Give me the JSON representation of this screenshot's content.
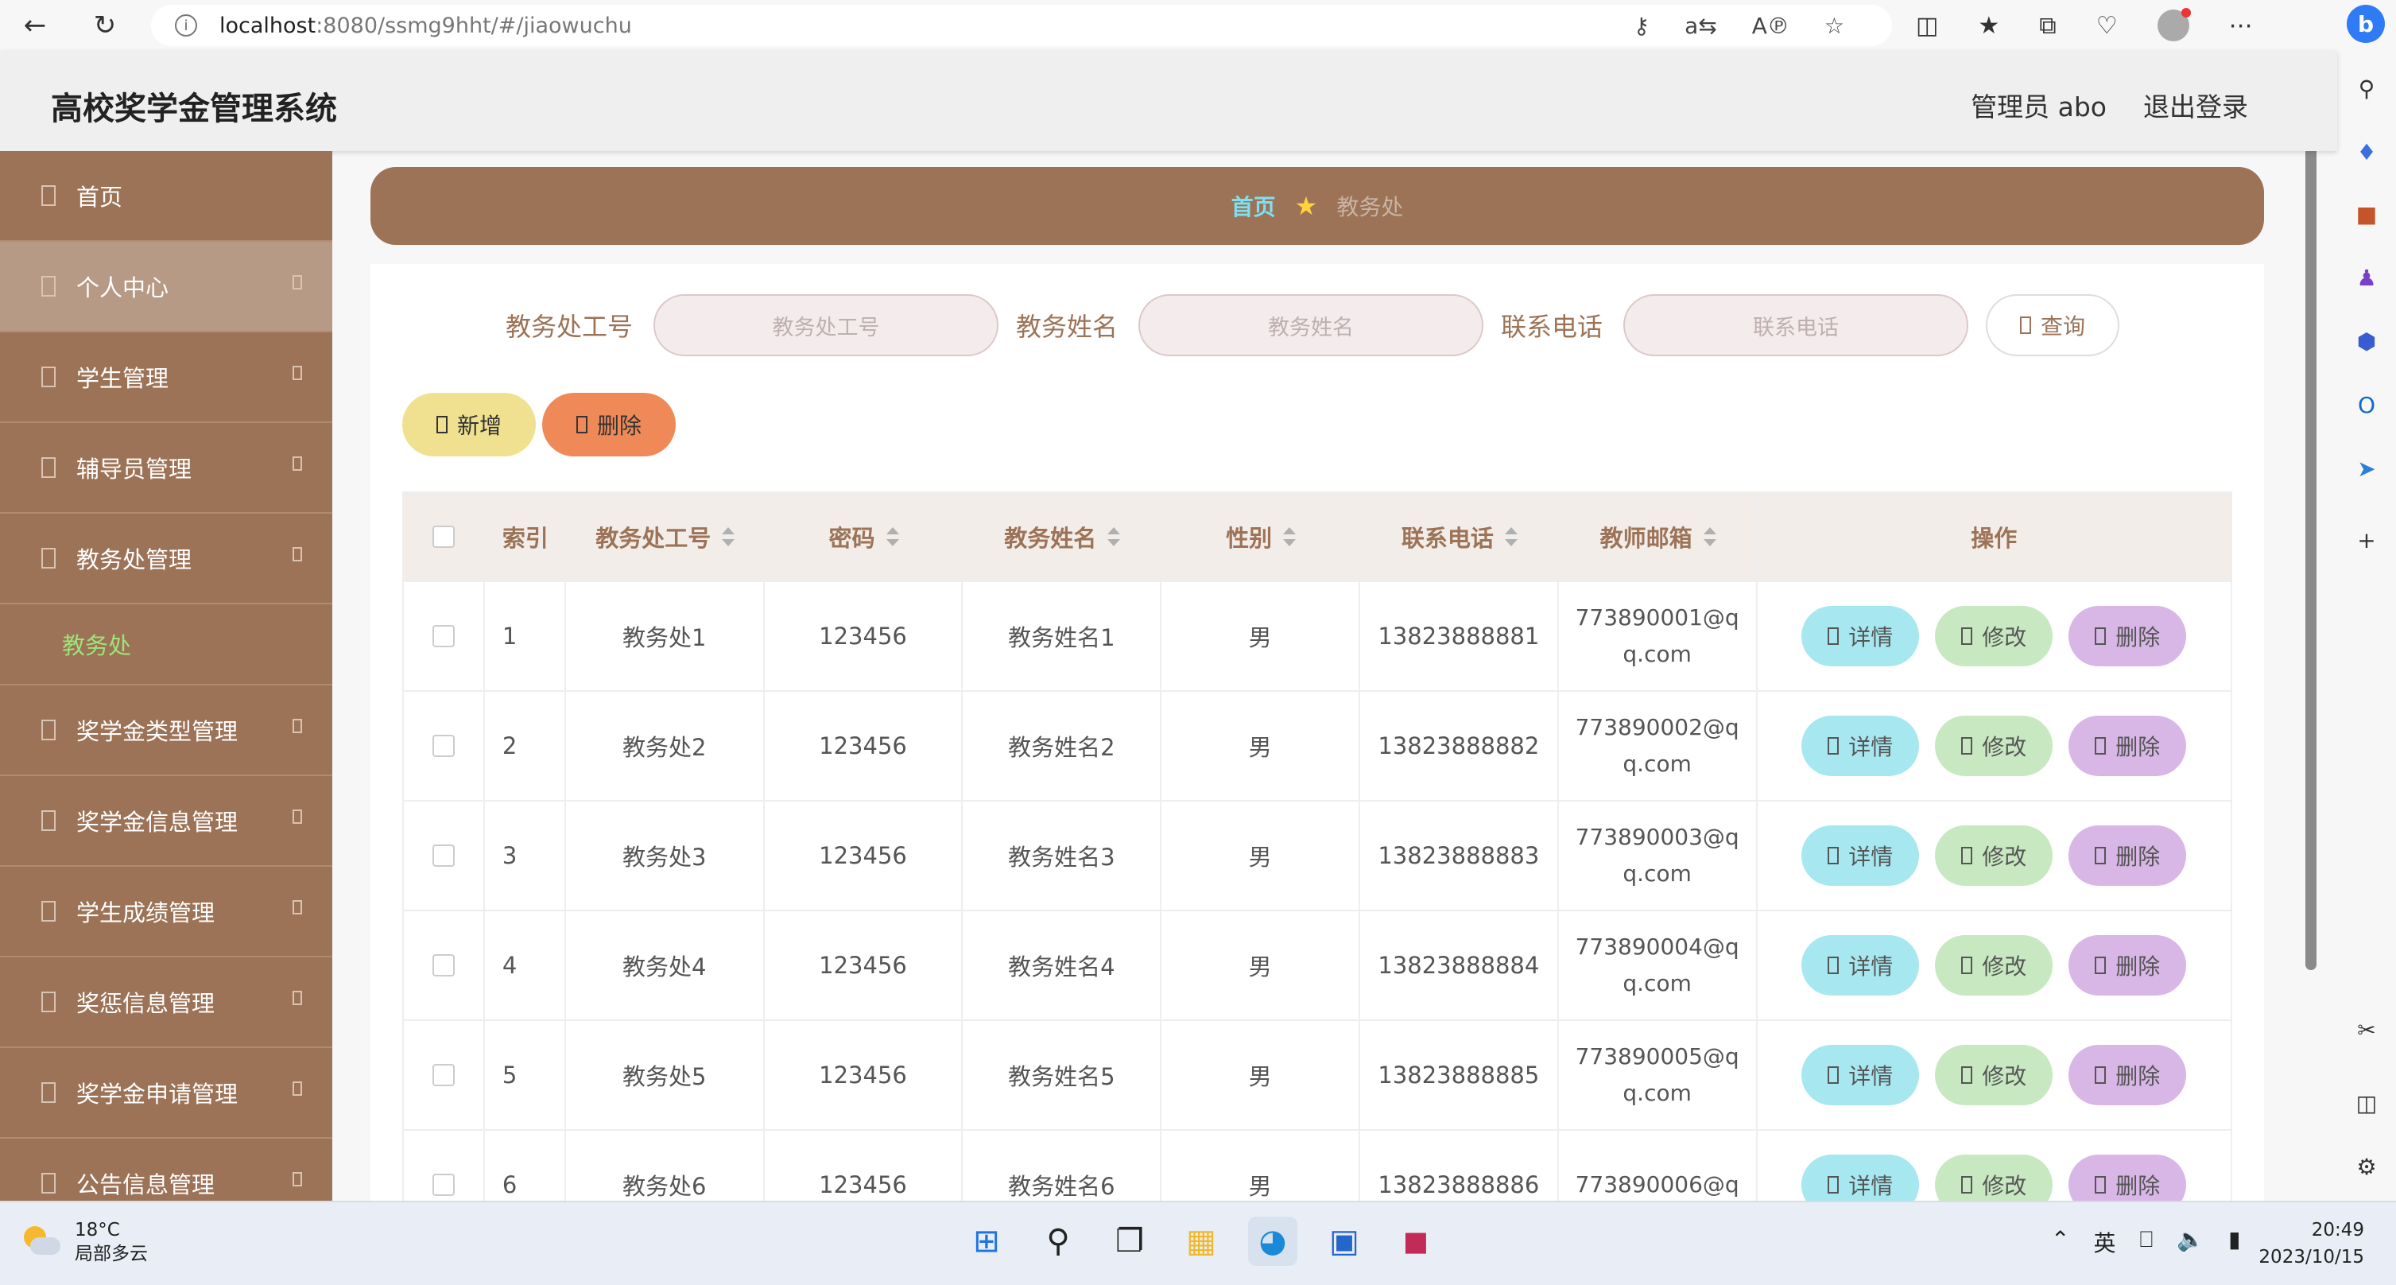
{
  "browser": {
    "url_host": "localhost",
    "url_path": ":8080/ssmg9hht/#/jiaowuchu"
  },
  "header": {
    "title": "高校奖学金管理系统",
    "user_label": "管理员 abo",
    "logout_label": "退出登录"
  },
  "sidebar": {
    "items": [
      {
        "label": "首页"
      },
      {
        "label": "个人中心"
      },
      {
        "label": "学生管理"
      },
      {
        "label": "辅导员管理"
      },
      {
        "label": "教务处管理"
      },
      {
        "label": "奖学金类型管理"
      },
      {
        "label": "奖学金信息管理"
      },
      {
        "label": "学生成绩管理"
      },
      {
        "label": "奖惩信息管理"
      },
      {
        "label": "奖学金申请管理"
      },
      {
        "label": "公告信息管理"
      }
    ],
    "submenu_label": "教务处"
  },
  "breadcrumb": {
    "home": "首页",
    "current": "教务处"
  },
  "search": {
    "field1_label": "教务处工号",
    "field1_placeholder": "教务处工号",
    "field2_label": "教务姓名",
    "field2_placeholder": "教务姓名",
    "field3_label": "联系电话",
    "field3_placeholder": "联系电话",
    "query_label": "查询"
  },
  "actions": {
    "add_label": "新增",
    "delete_label": "删除"
  },
  "table": {
    "headers": {
      "index": "索引",
      "id": "教务处工号",
      "password": "密码",
      "name": "教务姓名",
      "gender": "性别",
      "phone": "联系电话",
      "email": "教师邮箱",
      "ops": "操作"
    },
    "op_labels": {
      "detail": "详情",
      "edit": "修改",
      "delete": "删除"
    },
    "rows": [
      {
        "index": "1",
        "id": "教务处1",
        "password": "123456",
        "name": "教务姓名1",
        "gender": "男",
        "phone": "13823888881",
        "email_a": "773890001@q",
        "email_b": "q.com"
      },
      {
        "index": "2",
        "id": "教务处2",
        "password": "123456",
        "name": "教务姓名2",
        "gender": "男",
        "phone": "13823888882",
        "email_a": "773890002@q",
        "email_b": "q.com"
      },
      {
        "index": "3",
        "id": "教务处3",
        "password": "123456",
        "name": "教务姓名3",
        "gender": "男",
        "phone": "13823888883",
        "email_a": "773890003@q",
        "email_b": "q.com"
      },
      {
        "index": "4",
        "id": "教务处4",
        "password": "123456",
        "name": "教务姓名4",
        "gender": "男",
        "phone": "13823888884",
        "email_a": "773890004@q",
        "email_b": "q.com"
      },
      {
        "index": "5",
        "id": "教务处5",
        "password": "123456",
        "name": "教务姓名5",
        "gender": "男",
        "phone": "13823888885",
        "email_a": "773890005@q",
        "email_b": "q.com"
      },
      {
        "index": "6",
        "id": "教务处6",
        "password": "123456",
        "name": "教务姓名6",
        "gender": "男",
        "phone": "13823888886",
        "email_a": "773890006@q",
        "email_b": ""
      }
    ]
  },
  "taskbar": {
    "temperature": "18°C",
    "weather": "局部多云",
    "ime": "英",
    "time": "20:49",
    "date": "2023/10/15"
  },
  "colors": {
    "brand_brown": "#9c7357",
    "submenu_green": "#9fe37a",
    "breadcrumb_home": "#7ee0f0"
  }
}
